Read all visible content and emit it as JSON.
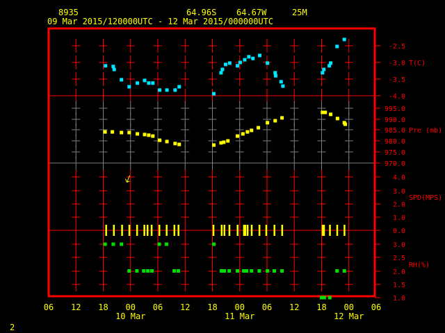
{
  "header": {
    "station": "8935",
    "lat": "64.96S",
    "lon": "64.67W",
    "elev": "25M",
    "period": "09 Mar 2015/120000UTC - 12 Mar 2015/000000UTC"
  },
  "footer": {
    "page": "2"
  },
  "colors": {
    "frame": "#ff0000",
    "text": "#ffff00",
    "temp": "#00e5ff",
    "pres": "#ffff00",
    "spd": "#ffff00",
    "rh": "#00e000",
    "grid_gray": "#808080"
  },
  "chart_data": {
    "type": "scatter",
    "x_unit": "hours since 09 Mar 2015 06UTC",
    "xlim": [
      0,
      72
    ],
    "x_ticks": [
      {
        "h": 0,
        "label": "06"
      },
      {
        "h": 6,
        "label": "12"
      },
      {
        "h": 12,
        "label": "18"
      },
      {
        "h": 18,
        "label": "00"
      },
      {
        "h": 24,
        "label": "06"
      },
      {
        "h": 30,
        "label": "12"
      },
      {
        "h": 36,
        "label": "18"
      },
      {
        "h": 42,
        "label": "00"
      },
      {
        "h": 48,
        "label": "06"
      },
      {
        "h": 54,
        "label": "12"
      },
      {
        "h": 60,
        "label": "18"
      },
      {
        "h": 66,
        "label": "00"
      },
      {
        "h": 72,
        "label": "06"
      }
    ],
    "date_labels": [
      {
        "h": 18,
        "label": "10 Mar"
      },
      {
        "h": 42,
        "label": "11 Mar"
      },
      {
        "h": 66,
        "label": "12 Mar"
      }
    ],
    "panels": [
      {
        "name": "T(C)",
        "ticks": [
          "-2.5",
          "-3.0",
          "-3.5",
          "-4.0"
        ],
        "ylim": [
          -4.0,
          -2.5
        ],
        "points": [
          [
            12.5,
            -3.1
          ],
          [
            14.2,
            -3.12
          ],
          [
            14.4,
            -3.21
          ],
          [
            16.0,
            -3.52
          ],
          [
            17.7,
            -3.73
          ],
          [
            19.5,
            -3.62
          ],
          [
            21.1,
            -3.54
          ],
          [
            22.0,
            -3.62
          ],
          [
            22.9,
            -3.62
          ],
          [
            24.4,
            -3.83
          ],
          [
            26.0,
            -3.83
          ],
          [
            27.8,
            -3.83
          ],
          [
            28.7,
            -3.73
          ],
          [
            36.3,
            -3.94
          ],
          [
            37.9,
            -3.31
          ],
          [
            38.2,
            -3.21
          ],
          [
            38.9,
            -3.06
          ],
          [
            39.8,
            -3.02
          ],
          [
            41.5,
            -3.1
          ],
          [
            42.1,
            -3.0
          ],
          [
            43.1,
            -2.92
          ],
          [
            44.0,
            -2.83
          ],
          [
            44.9,
            -2.88
          ],
          [
            46.4,
            -2.79
          ],
          [
            48.1,
            -3.02
          ],
          [
            49.8,
            -3.31
          ],
          [
            49.9,
            -3.4
          ],
          [
            51.1,
            -3.58
          ],
          [
            51.5,
            -3.71
          ],
          [
            60.2,
            -3.31
          ],
          [
            60.5,
            -3.21
          ],
          [
            61.7,
            -3.1
          ],
          [
            62.0,
            -3.02
          ],
          [
            63.4,
            -2.52
          ],
          [
            65.0,
            -2.31
          ]
        ]
      },
      {
        "name": "Pre (mb)",
        "ticks": [
          "995.0",
          "990.0",
          "985.0",
          "980.0",
          "975.0",
          "970.0"
        ],
        "ylim": [
          970,
          995
        ],
        "points": [
          [
            12.4,
            984.2
          ],
          [
            14.0,
            984.2
          ],
          [
            16.0,
            983.9
          ],
          [
            17.7,
            983.9
          ],
          [
            19.5,
            983.3
          ],
          [
            21.1,
            983.0
          ],
          [
            22.0,
            982.7
          ],
          [
            22.9,
            982.3
          ],
          [
            24.4,
            980.4
          ],
          [
            26.0,
            979.8
          ],
          [
            27.8,
            978.9
          ],
          [
            28.7,
            978.5
          ],
          [
            36.3,
            978.2
          ],
          [
            37.9,
            979.2
          ],
          [
            38.5,
            979.5
          ],
          [
            39.4,
            980.1
          ],
          [
            41.5,
            982.3
          ],
          [
            42.7,
            983.3
          ],
          [
            43.7,
            984.2
          ],
          [
            44.6,
            984.9
          ],
          [
            46.1,
            986.1
          ],
          [
            48.1,
            988.4
          ],
          [
            49.8,
            989.3
          ],
          [
            51.3,
            990.6
          ],
          [
            60.2,
            993.1
          ],
          [
            60.8,
            993.1
          ],
          [
            62.0,
            992.2
          ],
          [
            63.5,
            990.3
          ],
          [
            65.0,
            988.4
          ],
          [
            65.2,
            987.7
          ]
        ]
      },
      {
        "name": "SPD(MPS)",
        "ticks": [
          "4.0",
          "3.0",
          "2.0",
          "1.0",
          "0.0"
        ],
        "ylim": [
          0,
          4
        ],
        "points": [
          [
            12.6,
            0
          ],
          [
            14.3,
            0
          ],
          [
            16.1,
            0
          ],
          [
            17.7,
            0
          ],
          [
            19.4,
            0
          ],
          [
            21.0,
            0
          ],
          [
            21.7,
            0
          ],
          [
            22.6,
            0
          ],
          [
            24.3,
            0
          ],
          [
            25.9,
            0
          ],
          [
            27.6,
            0
          ],
          [
            28.5,
            0
          ],
          [
            36.2,
            0
          ],
          [
            38.0,
            0
          ],
          [
            38.6,
            0
          ],
          [
            39.7,
            0
          ],
          [
            41.5,
            0
          ],
          [
            42.9,
            0
          ],
          [
            43.2,
            0
          ],
          [
            43.7,
            0
          ],
          [
            44.6,
            0
          ],
          [
            46.3,
            0
          ],
          [
            47.8,
            0
          ],
          [
            49.6,
            0
          ],
          [
            51.3,
            0
          ],
          [
            60.2,
            0
          ],
          [
            60.5,
            0
          ],
          [
            61.8,
            0
          ],
          [
            63.4,
            0
          ],
          [
            65.0,
            0
          ]
        ],
        "arrow": [
          17.2,
          3.8
        ]
      },
      {
        "name": "RH(%)",
        "ticks": [
          "3.0",
          "2.5",
          "2.0",
          "1.5",
          "1.0"
        ],
        "ylim": [
          1.0,
          3.0
        ],
        "points": [
          [
            12.4,
            3.0
          ],
          [
            14.2,
            3.0
          ],
          [
            16.0,
            3.0
          ],
          [
            24.3,
            3.0
          ],
          [
            25.9,
            3.0
          ],
          [
            36.3,
            3.0
          ],
          [
            17.7,
            2.0
          ],
          [
            19.4,
            2.0
          ],
          [
            20.9,
            2.0
          ],
          [
            21.8,
            2.0
          ],
          [
            22.7,
            2.0
          ],
          [
            27.6,
            2.0
          ],
          [
            28.5,
            2.0
          ],
          [
            38.0,
            2.0
          ],
          [
            38.6,
            2.0
          ],
          [
            39.7,
            2.0
          ],
          [
            41.5,
            2.0
          ],
          [
            42.9,
            2.0
          ],
          [
            43.5,
            2.0
          ],
          [
            44.6,
            2.0
          ],
          [
            46.3,
            2.0
          ],
          [
            48.1,
            2.0
          ],
          [
            49.6,
            2.0
          ],
          [
            51.3,
            2.0
          ],
          [
            63.4,
            2.0
          ],
          [
            65.0,
            2.0
          ],
          [
            60.0,
            1.0
          ],
          [
            60.6,
            1.0
          ],
          [
            61.8,
            1.0
          ]
        ]
      }
    ]
  }
}
